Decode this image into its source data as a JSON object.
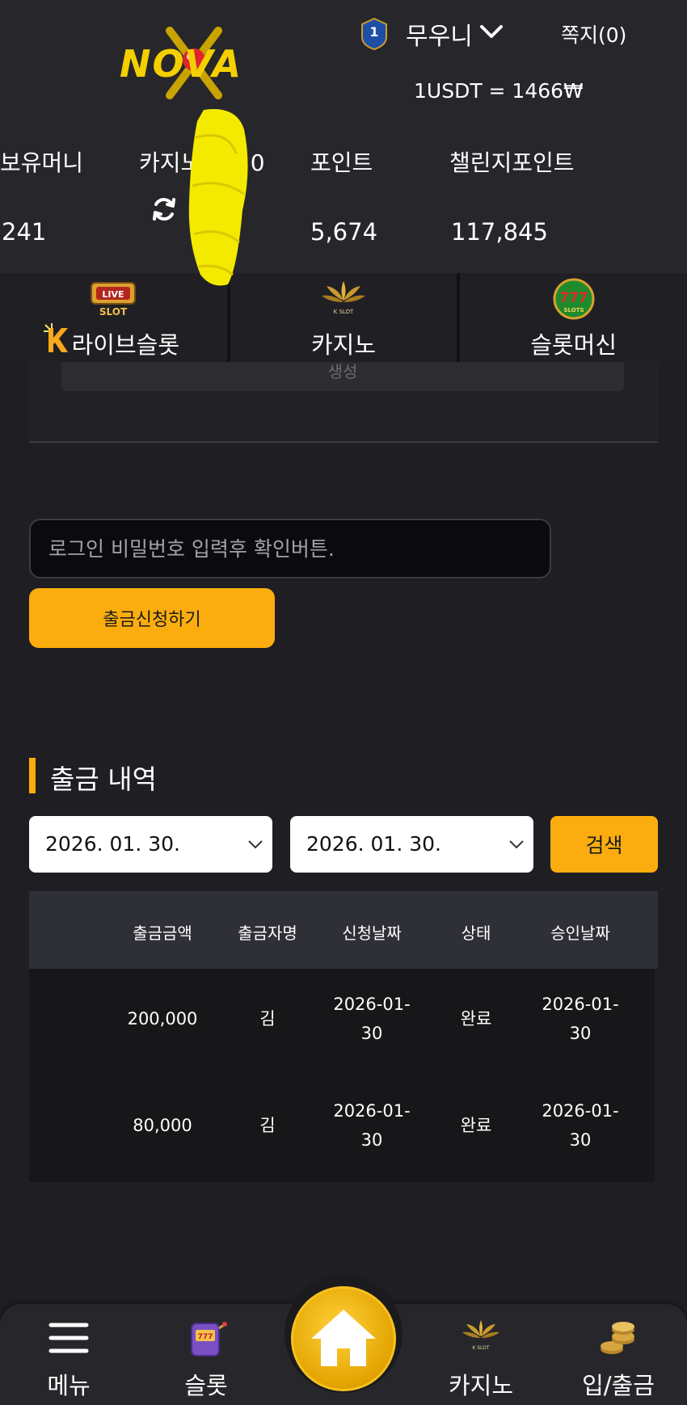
{
  "header": {
    "brand": "NOVA",
    "level": "1",
    "username": "무우니",
    "messages": "쪽지(0)",
    "exchange_rate": "1USDT = 1466₩"
  },
  "balances": [
    {
      "label": "보유머니",
      "value": "241"
    },
    {
      "label": "카지노머니 0",
      "value": ""
    },
    {
      "label": "포인트",
      "value": "5,674"
    },
    {
      "label": "챌린지포인트",
      "value": "117,845"
    }
  ],
  "categories": [
    {
      "label": "라이브슬롯",
      "icon": "live-slot-icon",
      "badge": "LIVE SLOT"
    },
    {
      "label": "카지노",
      "icon": "k-slot-lotus-icon",
      "badge": "K SLOT"
    },
    {
      "label": "슬롯머신",
      "icon": "777-slots-icon",
      "badge": "777 SLOTS"
    }
  ],
  "panel": {
    "partial_text": "생성"
  },
  "withdraw": {
    "password_placeholder": "로그인 비밀번호 입력후 확인버튼.",
    "submit_label": "출금신청하기"
  },
  "history": {
    "title": "출금 내역",
    "date_from": "2026. 01. 30.",
    "date_to": "2026. 01. 30.",
    "search_label": "검색",
    "columns": [
      "출금금액",
      "출금자명",
      "신청날짜",
      "상태",
      "승인날짜"
    ],
    "rows": [
      {
        "amount": "200,000",
        "name": "김",
        "requested": [
          "2026-01-",
          "30"
        ],
        "status": "완료",
        "approved": [
          "2026-01-",
          "30"
        ]
      },
      {
        "amount": "80,000",
        "name": "김",
        "requested": [
          "2026-01-",
          "30"
        ],
        "status": "완료",
        "approved": [
          "2026-01-",
          "30"
        ]
      }
    ]
  },
  "bottom_nav": [
    {
      "label": "메뉴",
      "icon": "hamburger-icon"
    },
    {
      "label": "슬롯",
      "icon": "slot-machine-icon"
    },
    {
      "label": "",
      "icon": "home-icon"
    },
    {
      "label": "카지노",
      "icon": "k-slot-lotus-icon"
    },
    {
      "label": "입/출금",
      "icon": "coins-icon"
    }
  ],
  "colors": {
    "accent": "#fbad0f",
    "header_bg": "#27272b",
    "page_bg": "#1f1f23"
  }
}
